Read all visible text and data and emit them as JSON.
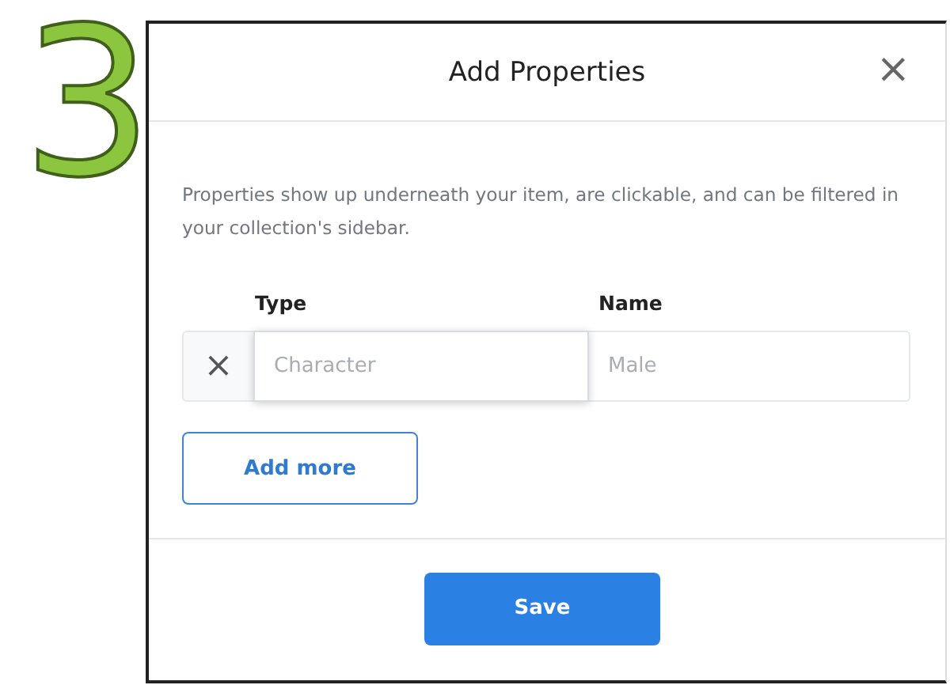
{
  "step_number": "3",
  "dialog": {
    "title": "Add Properties",
    "close_label": "×",
    "description": "Properties show up underneath your item, are clickable, and can be filtered in your collection's sidebar.",
    "columns": [
      "Type",
      "Name"
    ],
    "rows": [
      {
        "remove_label": "×",
        "type": {
          "placeholder": "Character",
          "focused": true
        },
        "name": {
          "placeholder": "Male",
          "focused": false
        }
      }
    ],
    "add_button": "Add more",
    "save_button": "Save"
  }
}
